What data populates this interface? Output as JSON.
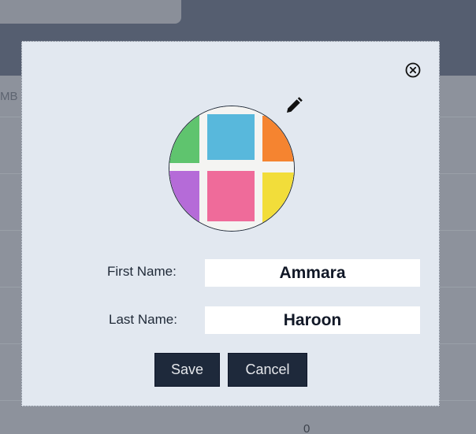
{
  "background": {
    "column_fragment": "MB",
    "cell_value": "0"
  },
  "modal": {
    "close_icon": "close-circle-icon",
    "edit_icon": "pencil-icon",
    "avatar_image": "sticky-notes-grid",
    "first_name": {
      "label": "First Name:",
      "value": "Ammara"
    },
    "last_name": {
      "label": "Last Name:",
      "value": "Haroon"
    },
    "save_label": "Save",
    "cancel_label": "Cancel"
  },
  "colors": {
    "backdrop": "#8d929c",
    "modal_bg": "#e2e8f0",
    "button_bg": "#1e293b",
    "note_green": "#5fc46e",
    "note_blue": "#58b8dc",
    "note_orange": "#f58430",
    "note_purple": "#b56bd8",
    "note_pink": "#ef6b9a",
    "note_yellow": "#f2dd3a"
  }
}
